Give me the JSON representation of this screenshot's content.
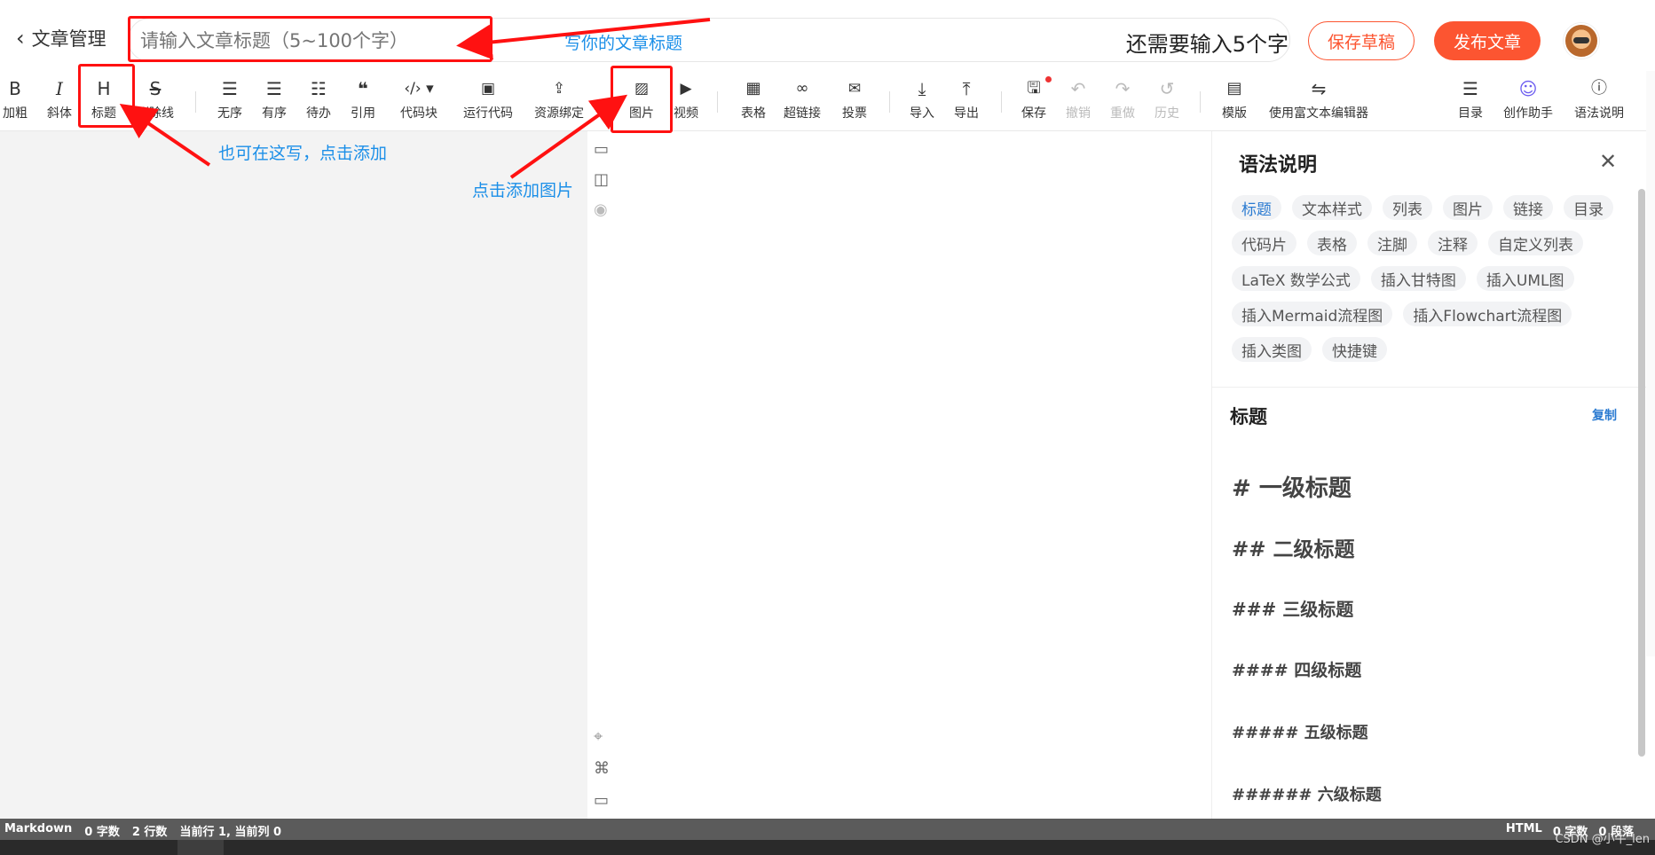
{
  "header": {
    "back_label": "文章管理",
    "title_placeholder": "请输入文章标题（5~100个字）",
    "remaining_text": "还需要输入5个字",
    "save_draft": "保存草稿",
    "publish": "发布文章"
  },
  "toolbar": {
    "bold": "加粗",
    "italic": "斜体",
    "heading": "标题",
    "strike": "删除线",
    "ul": "无序",
    "ol": "有序",
    "todo": "待办",
    "quote": "引用",
    "codeblock": "代码块",
    "runcode": "运行代码",
    "resource": "资源绑定",
    "image": "图片",
    "video": "视频",
    "table": "表格",
    "link": "超链接",
    "vote": "投票",
    "import": "导入",
    "export": "导出",
    "save": "保存",
    "undo": "撤销",
    "redo": "重做",
    "history": "历史",
    "template": "模版",
    "richtext": "使用富文本编辑器",
    "toc": "目录",
    "assistant": "创作助手",
    "syntax": "语法说明"
  },
  "toolbar_glyphs": {
    "bold": "B",
    "italic": "I",
    "heading": "H",
    "strike": "S",
    "quote": "❝"
  },
  "annotations": {
    "title_hint": "写你的文章标题",
    "heading_hint": "也可在这写，点击添加",
    "image_hint": "点击添加图片"
  },
  "panel": {
    "title": "语法说明",
    "tags": [
      "标题",
      "文本样式",
      "列表",
      "图片",
      "链接",
      "目录",
      "代码片",
      "表格",
      "注脚",
      "注释",
      "自定义列表",
      "LaTeX 数学公式",
      "插入甘特图",
      "插入UML图",
      "插入Mermaid流程图",
      "插入Flowchart流程图",
      "插入类图",
      "快捷键"
    ],
    "section_title": "标题",
    "copy": "复制",
    "headings": [
      "# 一级标题",
      "## 二级标题",
      "### 三级标题",
      "#### 四级标题",
      "##### 五级标题",
      "###### 六级标题"
    ]
  },
  "status": {
    "mode": "Markdown",
    "words": "0 字数",
    "lines": "2 行数",
    "cursor": "当前行 1, 当前列 0",
    "right_mode": "HTML",
    "right_words": "0 字数",
    "paragraphs": "0 段落"
  },
  "watermark": "CSDN @小牛_len",
  "colors": {
    "accent": "#fc5531",
    "annotation": "#1b8fe8",
    "highlight_box": "#ff1111",
    "link": "#2b7bd1"
  }
}
